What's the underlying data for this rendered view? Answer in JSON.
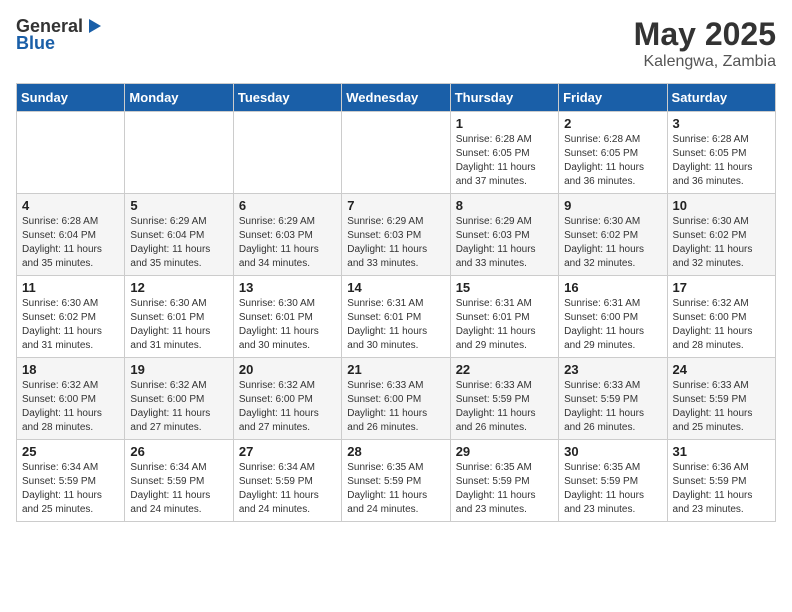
{
  "logo": {
    "line1": "General",
    "line2": "Blue",
    "arrow": "▶"
  },
  "title": "May 2025",
  "subtitle": "Kalengwa, Zambia",
  "days_of_week": [
    "Sunday",
    "Monday",
    "Tuesday",
    "Wednesday",
    "Thursday",
    "Friday",
    "Saturday"
  ],
  "weeks": [
    [
      {
        "day": "",
        "info": ""
      },
      {
        "day": "",
        "info": ""
      },
      {
        "day": "",
        "info": ""
      },
      {
        "day": "",
        "info": ""
      },
      {
        "day": "1",
        "info": "Sunrise: 6:28 AM\nSunset: 6:05 PM\nDaylight: 11 hours\nand 37 minutes."
      },
      {
        "day": "2",
        "info": "Sunrise: 6:28 AM\nSunset: 6:05 PM\nDaylight: 11 hours\nand 36 minutes."
      },
      {
        "day": "3",
        "info": "Sunrise: 6:28 AM\nSunset: 6:05 PM\nDaylight: 11 hours\nand 36 minutes."
      }
    ],
    [
      {
        "day": "4",
        "info": "Sunrise: 6:28 AM\nSunset: 6:04 PM\nDaylight: 11 hours\nand 35 minutes."
      },
      {
        "day": "5",
        "info": "Sunrise: 6:29 AM\nSunset: 6:04 PM\nDaylight: 11 hours\nand 35 minutes."
      },
      {
        "day": "6",
        "info": "Sunrise: 6:29 AM\nSunset: 6:03 PM\nDaylight: 11 hours\nand 34 minutes."
      },
      {
        "day": "7",
        "info": "Sunrise: 6:29 AM\nSunset: 6:03 PM\nDaylight: 11 hours\nand 33 minutes."
      },
      {
        "day": "8",
        "info": "Sunrise: 6:29 AM\nSunset: 6:03 PM\nDaylight: 11 hours\nand 33 minutes."
      },
      {
        "day": "9",
        "info": "Sunrise: 6:30 AM\nSunset: 6:02 PM\nDaylight: 11 hours\nand 32 minutes."
      },
      {
        "day": "10",
        "info": "Sunrise: 6:30 AM\nSunset: 6:02 PM\nDaylight: 11 hours\nand 32 minutes."
      }
    ],
    [
      {
        "day": "11",
        "info": "Sunrise: 6:30 AM\nSunset: 6:02 PM\nDaylight: 11 hours\nand 31 minutes."
      },
      {
        "day": "12",
        "info": "Sunrise: 6:30 AM\nSunset: 6:01 PM\nDaylight: 11 hours\nand 31 minutes."
      },
      {
        "day": "13",
        "info": "Sunrise: 6:30 AM\nSunset: 6:01 PM\nDaylight: 11 hours\nand 30 minutes."
      },
      {
        "day": "14",
        "info": "Sunrise: 6:31 AM\nSunset: 6:01 PM\nDaylight: 11 hours\nand 30 minutes."
      },
      {
        "day": "15",
        "info": "Sunrise: 6:31 AM\nSunset: 6:01 PM\nDaylight: 11 hours\nand 29 minutes."
      },
      {
        "day": "16",
        "info": "Sunrise: 6:31 AM\nSunset: 6:00 PM\nDaylight: 11 hours\nand 29 minutes."
      },
      {
        "day": "17",
        "info": "Sunrise: 6:32 AM\nSunset: 6:00 PM\nDaylight: 11 hours\nand 28 minutes."
      }
    ],
    [
      {
        "day": "18",
        "info": "Sunrise: 6:32 AM\nSunset: 6:00 PM\nDaylight: 11 hours\nand 28 minutes."
      },
      {
        "day": "19",
        "info": "Sunrise: 6:32 AM\nSunset: 6:00 PM\nDaylight: 11 hours\nand 27 minutes."
      },
      {
        "day": "20",
        "info": "Sunrise: 6:32 AM\nSunset: 6:00 PM\nDaylight: 11 hours\nand 27 minutes."
      },
      {
        "day": "21",
        "info": "Sunrise: 6:33 AM\nSunset: 6:00 PM\nDaylight: 11 hours\nand 26 minutes."
      },
      {
        "day": "22",
        "info": "Sunrise: 6:33 AM\nSunset: 5:59 PM\nDaylight: 11 hours\nand 26 minutes."
      },
      {
        "day": "23",
        "info": "Sunrise: 6:33 AM\nSunset: 5:59 PM\nDaylight: 11 hours\nand 26 minutes."
      },
      {
        "day": "24",
        "info": "Sunrise: 6:33 AM\nSunset: 5:59 PM\nDaylight: 11 hours\nand 25 minutes."
      }
    ],
    [
      {
        "day": "25",
        "info": "Sunrise: 6:34 AM\nSunset: 5:59 PM\nDaylight: 11 hours\nand 25 minutes."
      },
      {
        "day": "26",
        "info": "Sunrise: 6:34 AM\nSunset: 5:59 PM\nDaylight: 11 hours\nand 24 minutes."
      },
      {
        "day": "27",
        "info": "Sunrise: 6:34 AM\nSunset: 5:59 PM\nDaylight: 11 hours\nand 24 minutes."
      },
      {
        "day": "28",
        "info": "Sunrise: 6:35 AM\nSunset: 5:59 PM\nDaylight: 11 hours\nand 24 minutes."
      },
      {
        "day": "29",
        "info": "Sunrise: 6:35 AM\nSunset: 5:59 PM\nDaylight: 11 hours\nand 23 minutes."
      },
      {
        "day": "30",
        "info": "Sunrise: 6:35 AM\nSunset: 5:59 PM\nDaylight: 11 hours\nand 23 minutes."
      },
      {
        "day": "31",
        "info": "Sunrise: 6:36 AM\nSunset: 5:59 PM\nDaylight: 11 hours\nand 23 minutes."
      }
    ]
  ]
}
